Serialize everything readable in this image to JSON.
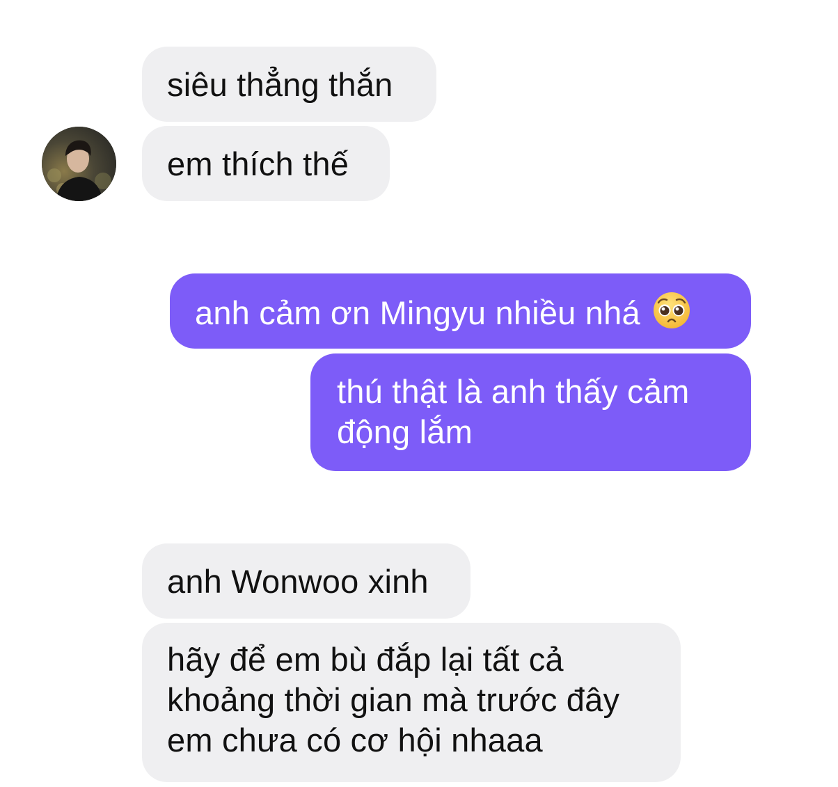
{
  "conversation": {
    "contact": {
      "avatar_icon": "profile-photo"
    },
    "colors": {
      "incoming_bubble": "#efeff1",
      "outgoing_bubble": "#7d5cf8",
      "incoming_text": "#111111",
      "outgoing_text": "#ffffff"
    },
    "messages": [
      {
        "direction": "incoming",
        "text": "siêu thẳng thắn"
      },
      {
        "direction": "incoming",
        "text": "em thích thế"
      },
      {
        "direction": "outgoing",
        "text": "anh cảm ơn Mingyu nhiều nhá",
        "emoji": "pleading-face"
      },
      {
        "direction": "outgoing",
        "text": "thú thật là anh thấy cảm động lắm"
      },
      {
        "direction": "incoming",
        "text": "anh Wonwoo xinh"
      },
      {
        "direction": "incoming",
        "text": "hãy để em bù đắp lại tất cả khoảng thời gian mà trước đây em chưa có cơ hội nhaaa"
      }
    ]
  }
}
